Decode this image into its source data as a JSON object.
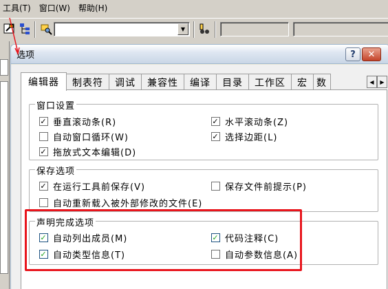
{
  "menubar": {
    "items": [
      {
        "label": "工具(T)",
        "hotkey": "T"
      },
      {
        "label": "窗口(W)",
        "hotkey": "W"
      },
      {
        "label": "帮助(H)",
        "hotkey": "H"
      }
    ]
  },
  "toolbar": {
    "find_combo_value": "",
    "drop_glyph": "▼"
  },
  "dialog": {
    "title": "选项",
    "help_glyph": "?",
    "close_glyph": "✕",
    "tabs": [
      {
        "label": "编辑器",
        "active": true
      },
      {
        "label": "制表符",
        "active": false
      },
      {
        "label": "调试",
        "active": false
      },
      {
        "label": "兼容性",
        "active": false
      },
      {
        "label": "编译",
        "active": false
      },
      {
        "label": "目录",
        "active": false
      },
      {
        "label": "工作区",
        "active": false
      },
      {
        "label": "宏",
        "active": false
      },
      {
        "label": "数",
        "active": false
      }
    ],
    "tab_scroll": {
      "left": "◀",
      "right": "▶"
    },
    "groups": {
      "window": {
        "title": "窗口设置",
        "options": [
          {
            "label": "垂直滚动条(R)",
            "checked": true
          },
          {
            "label": "水平滚动条(Z)",
            "checked": true
          },
          {
            "label": "自动窗口循环(W)",
            "checked": false
          },
          {
            "label": "选择边距(L)",
            "checked": true
          },
          {
            "label": "拖放式文本编辑(D)",
            "checked": true
          }
        ]
      },
      "save": {
        "title": "保存选项",
        "options": [
          {
            "label": "在运行工具前保存(V)",
            "checked": true
          },
          {
            "label": "保存文件前提示(P)",
            "checked": false
          },
          {
            "label": "自动重新载入被外部修改的文件(E)",
            "checked": false
          }
        ]
      },
      "completion": {
        "title": "声明完成选项",
        "options": [
          {
            "label": "自动列出成员(M)",
            "checked": true
          },
          {
            "label": "代码注释(C)",
            "checked": true
          },
          {
            "label": "自动类型信息(T)",
            "checked": true
          },
          {
            "label": "自动参数信息(A)",
            "checked": false
          }
        ]
      }
    }
  },
  "check_glyph": "✓",
  "colors": {
    "highlight": "#e8141c",
    "check": "#21a121"
  }
}
